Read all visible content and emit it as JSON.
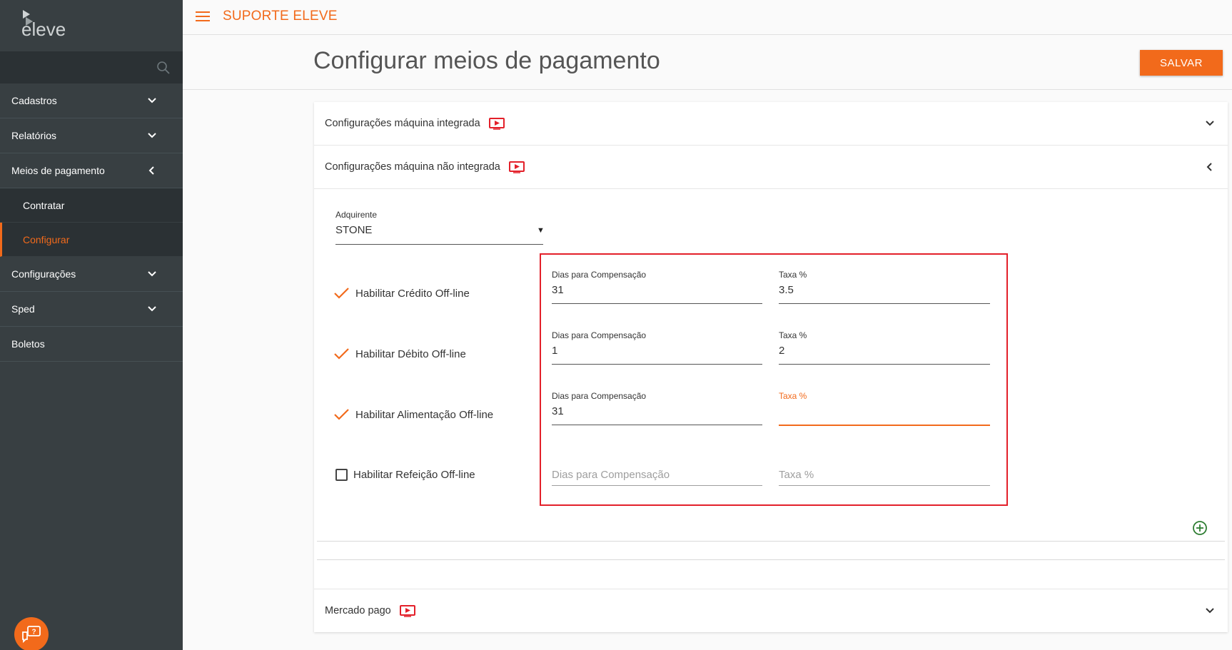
{
  "brand": {
    "logo_text": "eleve",
    "accent": "#f26a1b"
  },
  "topbar": {
    "title": "SUPORTE ELEVE"
  },
  "page": {
    "title": "Configurar meios de pagamento",
    "save_label": "SALVAR"
  },
  "sidebar": {
    "items": [
      {
        "label": "Cadastros",
        "icon": "chevron-down-icon"
      },
      {
        "label": "Relatórios",
        "icon": "chevron-down-icon"
      },
      {
        "label": "Meios de pagamento",
        "icon": "chevron-left-icon"
      },
      {
        "label": "Contratar"
      },
      {
        "label": "Configurar"
      },
      {
        "label": "Configurações",
        "icon": "chevron-down-icon"
      },
      {
        "label": "Sped",
        "icon": "chevron-down-icon"
      },
      {
        "label": "Boletos"
      }
    ]
  },
  "panels": [
    {
      "label": "Configurações máquina integrada"
    },
    {
      "label": "Configurações máquina não integrada"
    },
    {
      "label": "Mercado pago"
    }
  ],
  "form": {
    "acquirer_label": "Adquirente",
    "acquirer_value": "STONE",
    "rows": [
      {
        "check_label": "Habilitar Crédito Off-line",
        "checked": true,
        "days_label": "Dias para Compensação",
        "days_value": "31",
        "rate_label": "Taxa %",
        "rate_value": "3.5"
      },
      {
        "check_label": "Habilitar Débito Off-line",
        "checked": true,
        "days_label": "Dias para Compensação",
        "days_value": "1",
        "rate_label": "Taxa %",
        "rate_value": "2"
      },
      {
        "check_label": "Habilitar Alimentação Off-line",
        "checked": true,
        "days_label": "Dias para Compensação",
        "days_value": "31",
        "rate_label": "Taxa %",
        "rate_value": ""
      },
      {
        "check_label": "Habilitar Refeição Off-line",
        "checked": false,
        "days_placeholder": "Dias para Compensação",
        "rate_placeholder": "Taxa %"
      }
    ]
  }
}
